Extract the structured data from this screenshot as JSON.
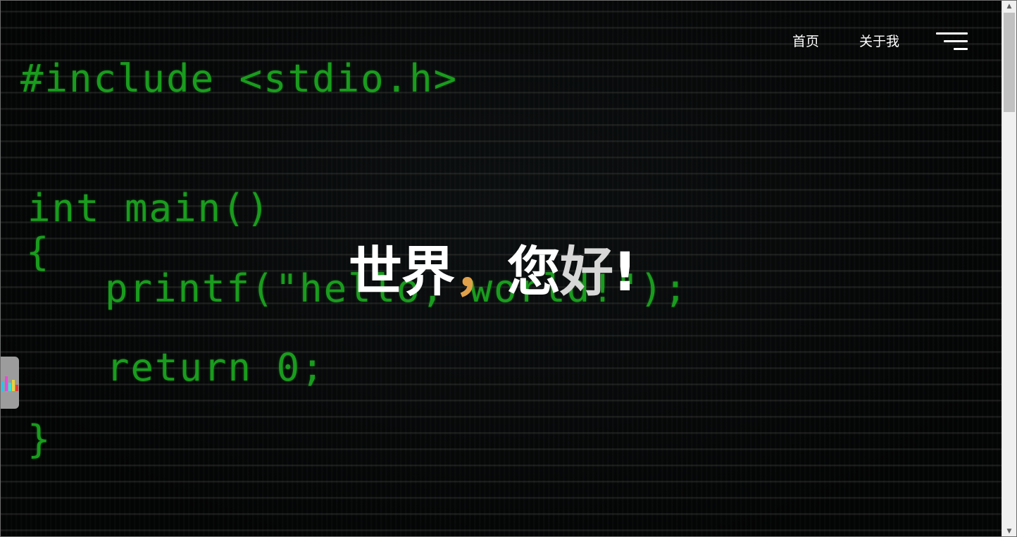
{
  "nav": {
    "home_label": "首页",
    "about_label": "关于我",
    "menu_icon": "hamburger-menu-icon"
  },
  "code_background": {
    "lines": [
      "#include <stdio.h>",
      "int main()",
      "{",
      "printf(\"hello, world!\");",
      "return 0;",
      "}"
    ],
    "color": "#1ba41f"
  },
  "hero": {
    "title_part1": "世界",
    "title_comma": "，",
    "title_part2": "您",
    "title_part3": "好",
    "title_part4": "!",
    "comma_color": "#e0a14a"
  },
  "side_widget": {
    "icon": "bar-chart-icon",
    "bar_colors": [
      "#2ec4e8",
      "#e84ad8",
      "#3ae0e0",
      "#e8d23a",
      "#e83a3a"
    ],
    "bar_levels": [
      0.55,
      0.8,
      0.45,
      0.6,
      0.35
    ]
  },
  "scrollbar": {
    "up_arrow": "▲",
    "down_arrow": "▼"
  }
}
